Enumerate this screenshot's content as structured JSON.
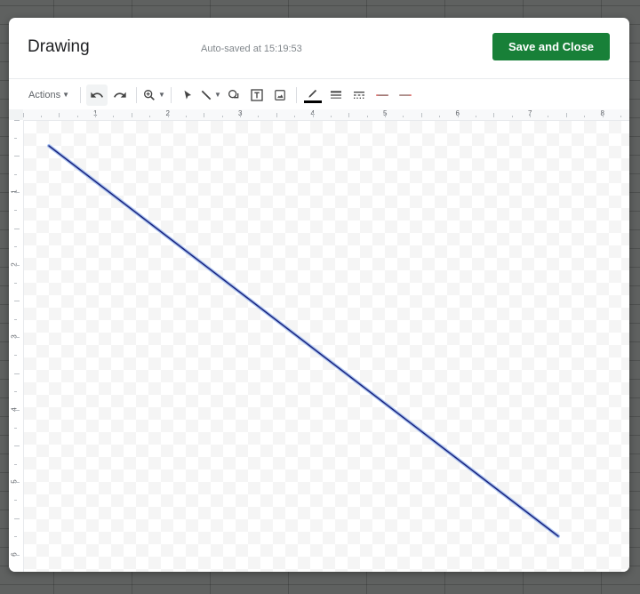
{
  "dialog": {
    "title": "Drawing",
    "autosave": "Auto-saved at 15:19:53",
    "save_label": "Save and Close"
  },
  "toolbar": {
    "actions_label": "Actions",
    "tools": [
      "undo-icon",
      "redo-icon",
      "zoom-icon",
      "select-icon",
      "line-icon",
      "shape-icon",
      "text-box-icon",
      "image-icon",
      "line-color-icon",
      "line-weight-icon",
      "line-dash-icon",
      "line-start-icon",
      "line-end-icon"
    ]
  },
  "ruler": {
    "horizontal": [
      "1",
      "2",
      "3",
      "4",
      "5",
      "6",
      "7",
      "8"
    ],
    "vertical": [
      "1",
      "2",
      "3",
      "4",
      "5",
      "6"
    ]
  },
  "colors": {
    "accent": "#188038",
    "line_stroke": "#1a237e",
    "line_color_swatch": "#000000",
    "arrow_color": "#c5221f"
  }
}
